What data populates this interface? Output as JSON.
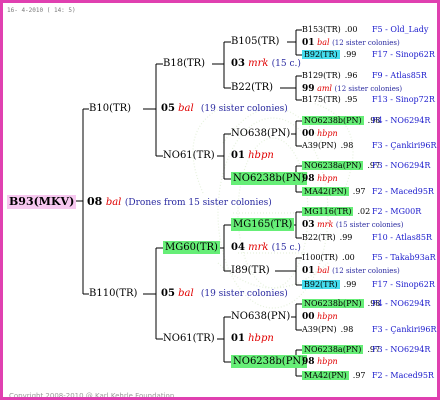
{
  "header": {
    "date": "16- 4-2010 ( 14: 5)"
  },
  "footer": {
    "copyright": "Copyright 2008-2010 @ Karl Kehrle Foundation."
  },
  "colors": {
    "border": "#e040b0",
    "green": "#66ee77",
    "pink": "#f7c8f0",
    "cyan": "#44ddee",
    "red": "#e00000",
    "blue": "#1a1acc"
  },
  "root": {
    "id": "B93(MKV)",
    "gen": "08",
    "mark": "bal",
    "note": "(Drones from 15 sister colonies)"
  },
  "g1": [
    {
      "id": "B10(TR)",
      "gen": "05",
      "mark": "bal",
      "note": "(19 sister colonies)"
    },
    {
      "id": "B110(TR)",
      "gen": "05",
      "mark": "bal",
      "note": "(19 sister colonies)"
    }
  ],
  "g2": [
    {
      "id": "B18(TR)",
      "gen": "03",
      "mark": "mrk",
      "note": "(15 c.)"
    },
    {
      "id": "NO61(TR)",
      "gen": "01",
      "mark": "hbpn",
      "note": ""
    },
    {
      "id": "MG60(TR)",
      "gen": "04",
      "mark": "mrk",
      "note": "(15 c.)"
    },
    {
      "id": "NO61(TR)",
      "gen": "01",
      "mark": "hbpn",
      "note": ""
    }
  ],
  "g3": [
    {
      "id": "B105(TR)",
      "gen": "01",
      "mark": "bal",
      "note": "(12 sister colonies)"
    },
    {
      "id": "B22(TR)",
      "gen": "99",
      "mark": "aml",
      "note": "(12 sister colonies)"
    },
    {
      "id": "NO638(PN)",
      "gen": "00",
      "mark": "hbpn",
      "note": ""
    },
    {
      "id": "NO6238b(PN)",
      "gen": "98",
      "mark": "hbpn",
      "note": ""
    },
    {
      "id": "MG165(TR)",
      "gen": "03",
      "mark": "mrk",
      "note": "(15 sister colonies)"
    },
    {
      "id": "I89(TR)",
      "gen": "01",
      "mark": "bal",
      "note": "(12 sister colonies)"
    },
    {
      "id": "NO638(PN)",
      "gen": "00",
      "mark": "hbpn",
      "note": ""
    },
    {
      "id": "NO6238b(PN)",
      "gen": "98",
      "mark": "hbpn",
      "note": ""
    }
  ],
  "g4": [
    {
      "id": "B153(TR)",
      "num": ".00",
      "code": "F5 - Old_Lady"
    },
    {
      "id": "B92(TR)",
      "num": ".99",
      "code": "F17 - Sinop62R"
    },
    {
      "id": "B129(TR)",
      "num": ".96",
      "code": "F9 - Atlas85R"
    },
    {
      "id": "B175(TR)",
      "num": ".95",
      "code": "F13 - Sinop72R"
    },
    {
      "id": "NO6238b(PN)",
      "num": ".98",
      "code": "F4 - NO6294R"
    },
    {
      "id": "A39(PN)",
      "num": ".98",
      "code": "F3 - Çankiri96R"
    },
    {
      "id": "NO6238a(PN)",
      "num": ".97",
      "code": "F3 - NO6294R"
    },
    {
      "id": "MA42(PN)",
      "num": ".97",
      "code": "F2 - Maced95R"
    },
    {
      "id": "MG116(TR)",
      "num": ".02",
      "code": "F2 - MG00R"
    },
    {
      "id": "B22(TR)",
      "num": ".99",
      "code": "F10 - Atlas85R"
    },
    {
      "id": "I100(TR)",
      "num": ".00",
      "code": "F5 - Takab93aR"
    },
    {
      "id": "B92(TR)",
      "num": ".99",
      "code": "F17 - Sinop62R"
    },
    {
      "id": "NO6238b(PN)",
      "num": ".98",
      "code": "F4 - NO6294R"
    },
    {
      "id": "A39(PN)",
      "num": ".98",
      "code": "F3 - Çankiri96R"
    },
    {
      "id": "NO6238a(PN)",
      "num": ".97",
      "code": "F3 - NO6294R"
    },
    {
      "id": "MA42(PN)",
      "num": ".97",
      "code": "F2 - Maced95R"
    }
  ]
}
